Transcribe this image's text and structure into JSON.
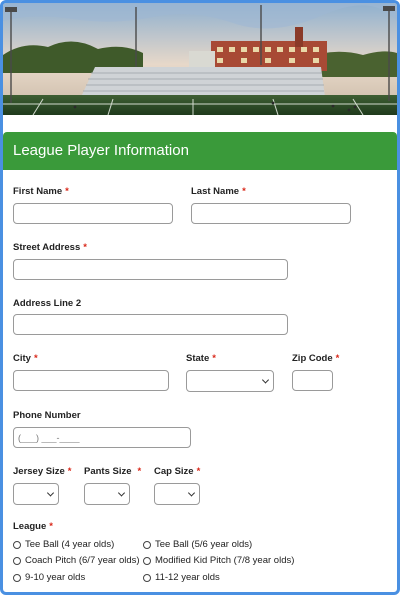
{
  "header": {
    "title": "League Player Information"
  },
  "fields": {
    "first_name": {
      "label": "First Name",
      "req": "*",
      "value": ""
    },
    "last_name": {
      "label": "Last Name",
      "req": "*",
      "value": ""
    },
    "street": {
      "label": "Street Address",
      "req": "*",
      "value": ""
    },
    "address2": {
      "label": "Address Line 2",
      "value": ""
    },
    "city": {
      "label": "City",
      "req": "*",
      "value": ""
    },
    "state": {
      "label": "State",
      "req": "*",
      "value": ""
    },
    "zip": {
      "label": "Zip Code",
      "req": "*",
      "value": ""
    },
    "phone": {
      "label": "Phone Number",
      "placeholder": "(___) ___-____"
    },
    "jersey": {
      "label": "Jersey Size",
      "req": "*",
      "value": ""
    },
    "pants": {
      "label": "Pants Size",
      "req": "*",
      "value": ""
    },
    "cap": {
      "label": "Cap Size",
      "req": "*",
      "value": ""
    }
  },
  "league": {
    "label": "League",
    "req": "*",
    "options": [
      "Tee Ball (4 year olds)",
      "Tee Ball (5/6 year olds)",
      "Coach Pitch (6/7 year olds)",
      "Modified Kid Pitch (7/8 year olds)",
      "9-10 year olds",
      "11-12 year olds"
    ]
  },
  "colors": {
    "header_bg": "#3a9a3a",
    "required": "#d9281a",
    "frame_border": "#4a90e2"
  },
  "icons": {
    "select_arrow": "chevron-down-icon",
    "radio": "radio-empty-icon"
  }
}
